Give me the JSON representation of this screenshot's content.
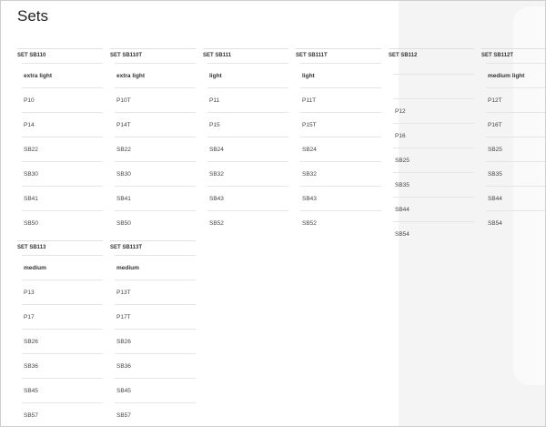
{
  "page": {
    "title": "Sets"
  },
  "sets": [
    {
      "name": "SET SB110",
      "items": [
        "extra light",
        "P10",
        "P14",
        "SB22",
        "SB30",
        "SB41",
        "SB50"
      ]
    },
    {
      "name": "SET SB110T",
      "items": [
        "extra light",
        "P10T",
        "P14T",
        "SB22",
        "SB30",
        "SB41",
        "SB50"
      ]
    },
    {
      "name": "SET SB111",
      "items": [
        "light",
        "P11",
        "P15",
        "SB24",
        "SB32",
        "SB43",
        "SB52"
      ]
    },
    {
      "name": "SET SB111T",
      "items": [
        "light",
        "P11T",
        "P15T",
        "SB24",
        "SB32",
        "SB43",
        "SB52"
      ]
    },
    {
      "name": "SET SB112",
      "items": [
        "",
        "P12",
        "P16",
        "SB25",
        "SB35",
        "SB44",
        "SB54"
      ]
    },
    {
      "name": "SET SB112T",
      "items": [
        "medium light",
        "P12T",
        "P16T",
        "SB25",
        "SB35",
        "SB44",
        "SB54"
      ]
    },
    {
      "name": "SET SB113",
      "items": [
        "medium",
        "P13",
        "P17",
        "SB26",
        "SB36",
        "SB45",
        "SB57"
      ]
    },
    {
      "name": "SET SB113T",
      "items": [
        "medium",
        "P13T",
        "P17T",
        "SB26",
        "SB36",
        "SB45",
        "SB57"
      ]
    }
  ]
}
